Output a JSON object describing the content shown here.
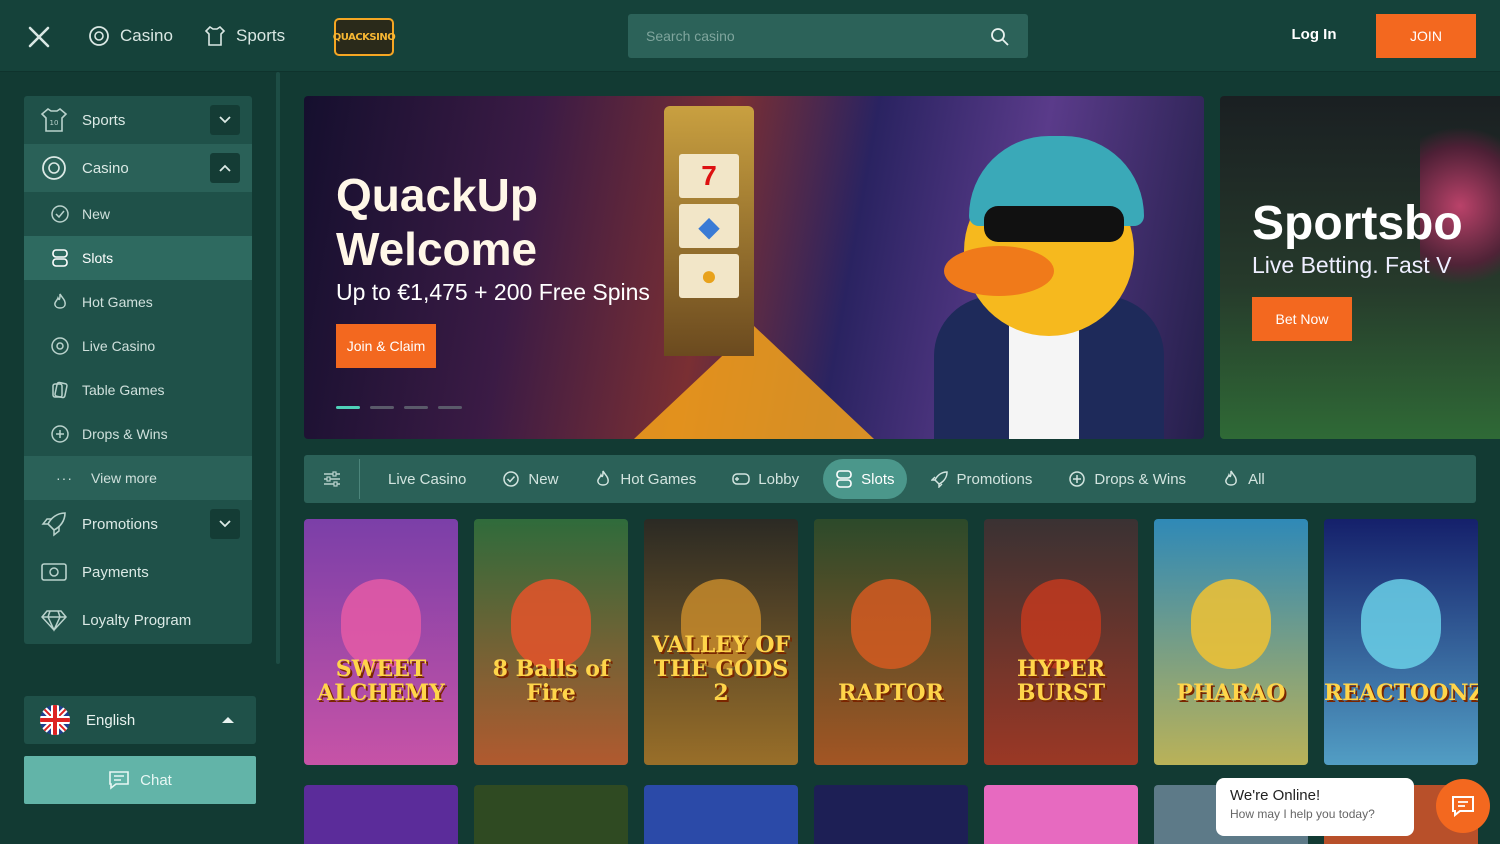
{
  "header": {
    "close_icon": "close-icon",
    "nav": [
      {
        "label": "Casino",
        "icon": "casino-chip-icon"
      },
      {
        "label": "Sports",
        "icon": "jersey-icon"
      }
    ],
    "logo_text": "QUACKSINO",
    "search_placeholder": "Search casino",
    "login_label": "Log In",
    "join_label": "JOIN"
  },
  "sidebar": {
    "sports": "Sports",
    "casino": "Casino",
    "sub": {
      "new": "New",
      "slots": "Slots",
      "hot": "Hot Games",
      "live": "Live Casino",
      "table": "Table Games",
      "drops": "Drops & Wins",
      "more": "View more"
    },
    "promotions": "Promotions",
    "payments": "Payments",
    "loyalty": "Loyalty Program",
    "language": "English",
    "chat": "Chat"
  },
  "banner": {
    "title": "QuackUp Welcome",
    "subtitle": "Up to €1,475 + 200 Free Spins",
    "cta": "Join & Claim",
    "reels": [
      "7",
      "◆",
      "●"
    ],
    "slide_count": 4,
    "active_slide": 1
  },
  "banner2": {
    "title": "Sportsbo",
    "subtitle": "Live Betting. Fast V",
    "cta": "Bet Now"
  },
  "categories": [
    {
      "label": "Live Casino",
      "icon": ""
    },
    {
      "label": "New",
      "icon": "badge-check-icon"
    },
    {
      "label": "Hot Games",
      "icon": "flame-icon"
    },
    {
      "label": "Lobby",
      "icon": "gamepad-icon"
    },
    {
      "label": "Slots",
      "icon": "slots-icon",
      "active": true
    },
    {
      "label": "Promotions",
      "icon": "rocket-icon"
    },
    {
      "label": "Drops & Wins",
      "icon": "plus-circle-icon"
    },
    {
      "label": "All",
      "icon": "flame-icon"
    }
  ],
  "games": [
    {
      "title": "SWEET ALCHEMY",
      "bg": "#7b3fa8",
      "accent": "#e55ba6"
    },
    {
      "title": "8 Balls of Fire",
      "bg": "#2f6b3b",
      "accent": "#e5532a"
    },
    {
      "title": "VALLEY OF THE GODS 2",
      "bg": "#2b2a24",
      "accent": "#c58a2b"
    },
    {
      "title": "RAPTOR",
      "bg": "#2c4a2a",
      "accent": "#d35a21"
    },
    {
      "title": "HYPER BURST",
      "bg": "#3a3233",
      "accent": "#c23a1f"
    },
    {
      "title": "PHARAO",
      "bg": "#2f89b7",
      "accent": "#f1c232"
    },
    {
      "title": "REACTOONZ",
      "bg": "#15206b",
      "accent": "#6ad0e8"
    }
  ],
  "games_row2": [
    {
      "bg": "#5b2c9a"
    },
    {
      "bg": "#2f4a22"
    },
    {
      "bg": "#2b4aa8"
    },
    {
      "bg": "#1d1f55"
    },
    {
      "bg": "#e76ac0"
    },
    {
      "bg": "#5d7a88"
    },
    {
      "bg": "#b8502a"
    }
  ],
  "chat_widget": {
    "title": "We're Online!",
    "message": "How may I help you today?"
  },
  "colors": {
    "accent_orange": "#f3681f",
    "sidebar_bg": "#1f5149",
    "active_tab": "#4b978b"
  }
}
